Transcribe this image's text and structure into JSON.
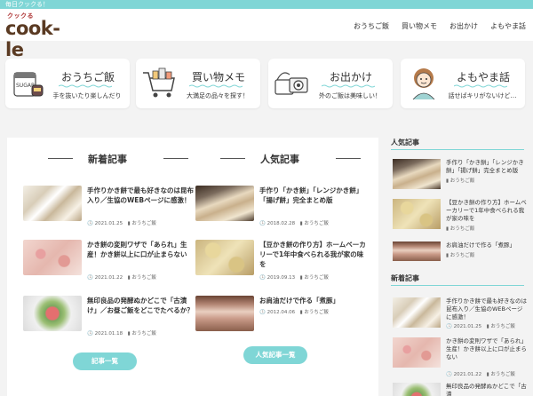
{
  "topbar": {
    "text": "毎日クックる！"
  },
  "site": {
    "logo_small": "クックる",
    "logo_main": "cook-le"
  },
  "nav": [
    "おうちご飯",
    "買い物メモ",
    "お出かけ",
    "よもやま話"
  ],
  "categories": [
    {
      "title": "おうちご飯",
      "sub": "手を抜いたり楽しんだり",
      "icon": "jar-icon"
    },
    {
      "title": "買い物メモ",
      "sub": "大満足の品々を探す！",
      "icon": "shopping-cart-icon"
    },
    {
      "title": "お出かけ",
      "sub": "外のご飯は美味しい！",
      "icon": "camera-bag-icon"
    },
    {
      "title": "よもやま話",
      "sub": "話せばキリがないけど…",
      "icon": "woman-avatar-icon"
    }
  ],
  "new_posts": {
    "heading": "新着記事",
    "items": [
      {
        "title": "手作りかき餅で最も好きなのは昆布入り／生協のWEBページに感激！",
        "date": "2021.01.25",
        "category": "おうちご飯"
      },
      {
        "title": "かき餅の変則ワザで「あられ」生産！かき餅以上に口が止まらない",
        "date": "2021.01.22",
        "category": "おうちご飯"
      },
      {
        "title": "無印良品の発酵ぬかどこで「古漬け」／お昼ご飯をどこでたべるか？",
        "date": "2021.01.18",
        "category": "おうちご飯"
      }
    ],
    "button": "記事一覧"
  },
  "popular_posts": {
    "heading": "人気記事",
    "items": [
      {
        "title": "手作り「かき餅」「レンジかき餅」「揚げ餅」完全まとめ版",
        "date": "2018.02.28",
        "category": "おうちご飯"
      },
      {
        "title": "【豆かき餅の作り方】ホームベーカリーで1年中食べられる我が家の味を",
        "date": "2019.09.13",
        "category": "おうちご飯"
      },
      {
        "title": "お肩油だけで作る「煮豚」",
        "date": "2012.04.06",
        "category": "おうちご飯"
      }
    ],
    "button": "人気記事一覧"
  },
  "sidebar": {
    "popular_heading": "人気記事",
    "popular": [
      {
        "title": "手作り「かき餅」「レンジかき餅」「揚げ餅」完全まとめ版",
        "category": "おうちご飯"
      },
      {
        "title": "【豆かき餅の作り方】ホームベーカリーで1年中食べられる我が家の味を",
        "category": "おうちご飯"
      },
      {
        "title": "お肩油だけで作る「煮豚」",
        "category": "おうちご飯"
      }
    ],
    "new_heading": "新着記事",
    "new": [
      {
        "title": "手作りかき餅で最も好きなのは昆布入り／生協のWEBページに感激！",
        "date": "2021.01.25",
        "category": "おうちご飯"
      },
      {
        "title": "かき餅の変則ワザで「あられ」生産！かき餅以上に口が止まらない",
        "date": "2021.01.22",
        "category": "おうちご飯"
      },
      {
        "title": "無印良品の発酵ぬかどこで「古漬",
        "category": ""
      }
    ]
  },
  "colors": {
    "accent": "#7fd6d6",
    "logo": "#5a3a22"
  }
}
